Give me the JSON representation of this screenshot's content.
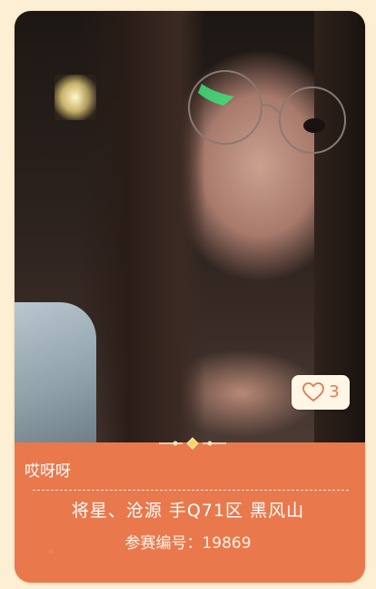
{
  "card": {
    "photo_alt": "contestant-photo",
    "like": {
      "icon": "heart-outline-icon",
      "count": "3"
    },
    "name": "哎呀呀",
    "team": "将星、沧源 手Q71区 黑风山",
    "entry_label": "参赛编号：",
    "entry_number": "19869",
    "entry_full": "参赛编号：19869"
  },
  "colors": {
    "background": "#fcefd3",
    "card_accent": "#e9794c",
    "like_bg": "#fff6e6",
    "text": "#ffffff"
  }
}
